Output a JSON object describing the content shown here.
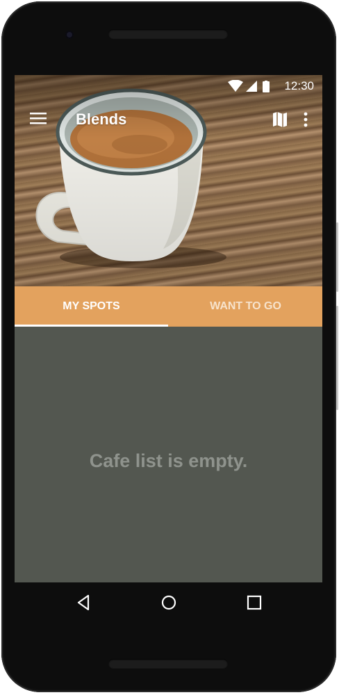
{
  "status_bar": {
    "time": "12:30",
    "icons": [
      "wifi-icon",
      "signal-icon",
      "battery-icon"
    ]
  },
  "toolbar": {
    "title": "Blends",
    "icons": [
      "menu-icon",
      "map-icon",
      "more-vert-icon"
    ]
  },
  "tabs": [
    {
      "label": "MY SPOTS",
      "selected": true
    },
    {
      "label": "WANT TO GO",
      "selected": false
    }
  ],
  "content": {
    "empty_message": "Cafe list is empty."
  },
  "nav_bar": {
    "icons": [
      "back-icon",
      "home-icon",
      "recents-icon"
    ]
  },
  "colors": {
    "accent": "#e3a25e",
    "background": "#535750",
    "empty_text": "#8f938d"
  }
}
